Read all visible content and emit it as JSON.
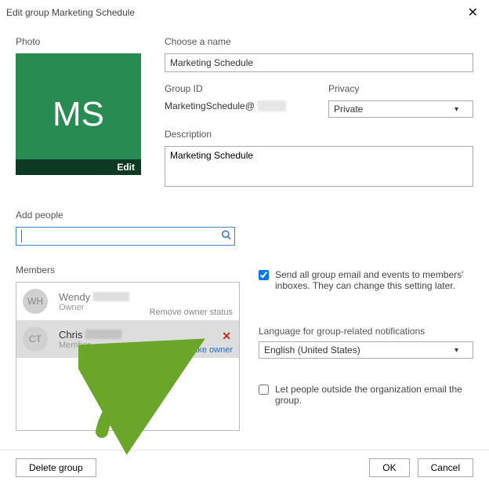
{
  "title": "Edit group Marketing Schedule",
  "photo": {
    "section_label": "Photo",
    "initials": "MS",
    "edit_label": "Edit"
  },
  "name": {
    "label": "Choose a name",
    "value": "Marketing Schedule"
  },
  "group_id": {
    "label": "Group ID",
    "value": "MarketingSchedule@"
  },
  "privacy": {
    "label": "Privacy",
    "value": "Private"
  },
  "description": {
    "label": "Description",
    "value": "Marketing Schedule"
  },
  "add_people": {
    "label": "Add people",
    "value": ""
  },
  "members": {
    "label": "Members",
    "items": [
      {
        "initials": "WH",
        "name": "Wendy",
        "role": "Owner",
        "statusLink": "Remove owner status"
      },
      {
        "initials": "CT",
        "name": "Chris",
        "role": "Member",
        "statusLink": "Make owner"
      }
    ]
  },
  "settings": {
    "send_label": "Send all group email and events to members' inboxes. They can change this setting later.",
    "send_checked": true,
    "lang_label": "Language for group-related notifications",
    "lang_value": "English (United States)",
    "external_label": "Let people outside the organization email the group.",
    "external_checked": false
  },
  "footer": {
    "delete": "Delete group",
    "ok": "OK",
    "cancel": "Cancel"
  }
}
